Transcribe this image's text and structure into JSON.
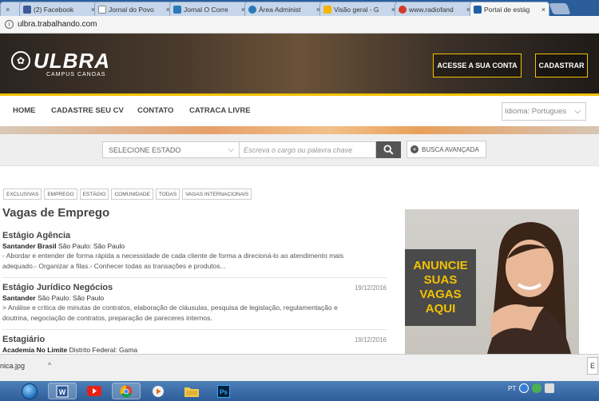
{
  "browser": {
    "tabs": [
      {
        "title": "",
        "favicon_color": "#6a8fc4",
        "active": false
      },
      {
        "title": "(2) Facebook",
        "favicon_color": "#3b5998",
        "active": false
      },
      {
        "title": "Jornal do Povo",
        "favicon_color": "#ffffff",
        "active": false
      },
      {
        "title": "Jornal O Corre",
        "favicon_color": "#2a7ab8",
        "active": false
      },
      {
        "title": "Área Administ",
        "favicon_color": "#2a7ab8",
        "active": false
      },
      {
        "title": "Visão geral - G",
        "favicon_color": "#f4b400",
        "active": false
      },
      {
        "title": "www.radiofand",
        "favicon_color": "#d23b2a",
        "active": false
      },
      {
        "title": "Portal de estág",
        "favicon_color": "#1e5fa8",
        "active": true
      }
    ],
    "close_glyph": "×",
    "url": "ulbra.trabalhando.com"
  },
  "header": {
    "logo_text": "ULBRA",
    "logo_sub": "CAMPUS CANOAS",
    "login_label": "ACESSE A SUA CONTA",
    "register_label": "CADASTRAR"
  },
  "nav": {
    "items": [
      "HOME",
      "CADASTRE SEU CV",
      "CONTATO",
      "CATRACA LIVRE"
    ],
    "language": "Idioma: Portugues"
  },
  "search": {
    "state_label": "SELECIONE ESTADO",
    "keyword_placeholder": "Escreva o cargo ou palavra chave",
    "advanced_label": "BUSCA AVANÇADA"
  },
  "filters": [
    "EXCLUSIVAS",
    "EMPREGO",
    "ESTÁGIO",
    "COMUNIDADE",
    "TODAS",
    "VAGAS INTERNACIONAIS"
  ],
  "page_title": "Vagas de Emprego",
  "jobs": [
    {
      "title": "Estágio Agência",
      "date": "",
      "company": "Santander Brasil",
      "location": "São Paulo: São Paulo",
      "desc1": "- Abordar e entender de forma rápida a necessidade de cada cliente de forma a direcioná-lo ao atendimento mais",
      "desc2": "adequado.- Organizar a filas.- Conhecer todas as transações e produtos..."
    },
    {
      "title": "Estágio Jurídico Negócios",
      "date": "19/12/2016",
      "company": "Santander",
      "location": "São Paulo: São Paulo",
      "desc1": "> Análise e crítica de minutas de contratos, elaboração de cláusulas, pesquisa de legislação, regulamentação e",
      "desc2": "doutrina, negociação de contratos, preparação de pareceres internos."
    },
    {
      "title": "Estagiário",
      "date": "19/12/2016",
      "company": "Academia No Limite",
      "location": "Distrito Federal: Gama",
      "desc1": "",
      "desc2": ""
    }
  ],
  "ad": {
    "line1": "ANUNCIE",
    "line2": "SUAS",
    "line3": "VAGAS",
    "line4": "AQUI"
  },
  "download": {
    "filename": "nica.jpg",
    "chevron": "^",
    "right_label": "E"
  },
  "taskbar": {
    "tray_lang": "PT"
  }
}
